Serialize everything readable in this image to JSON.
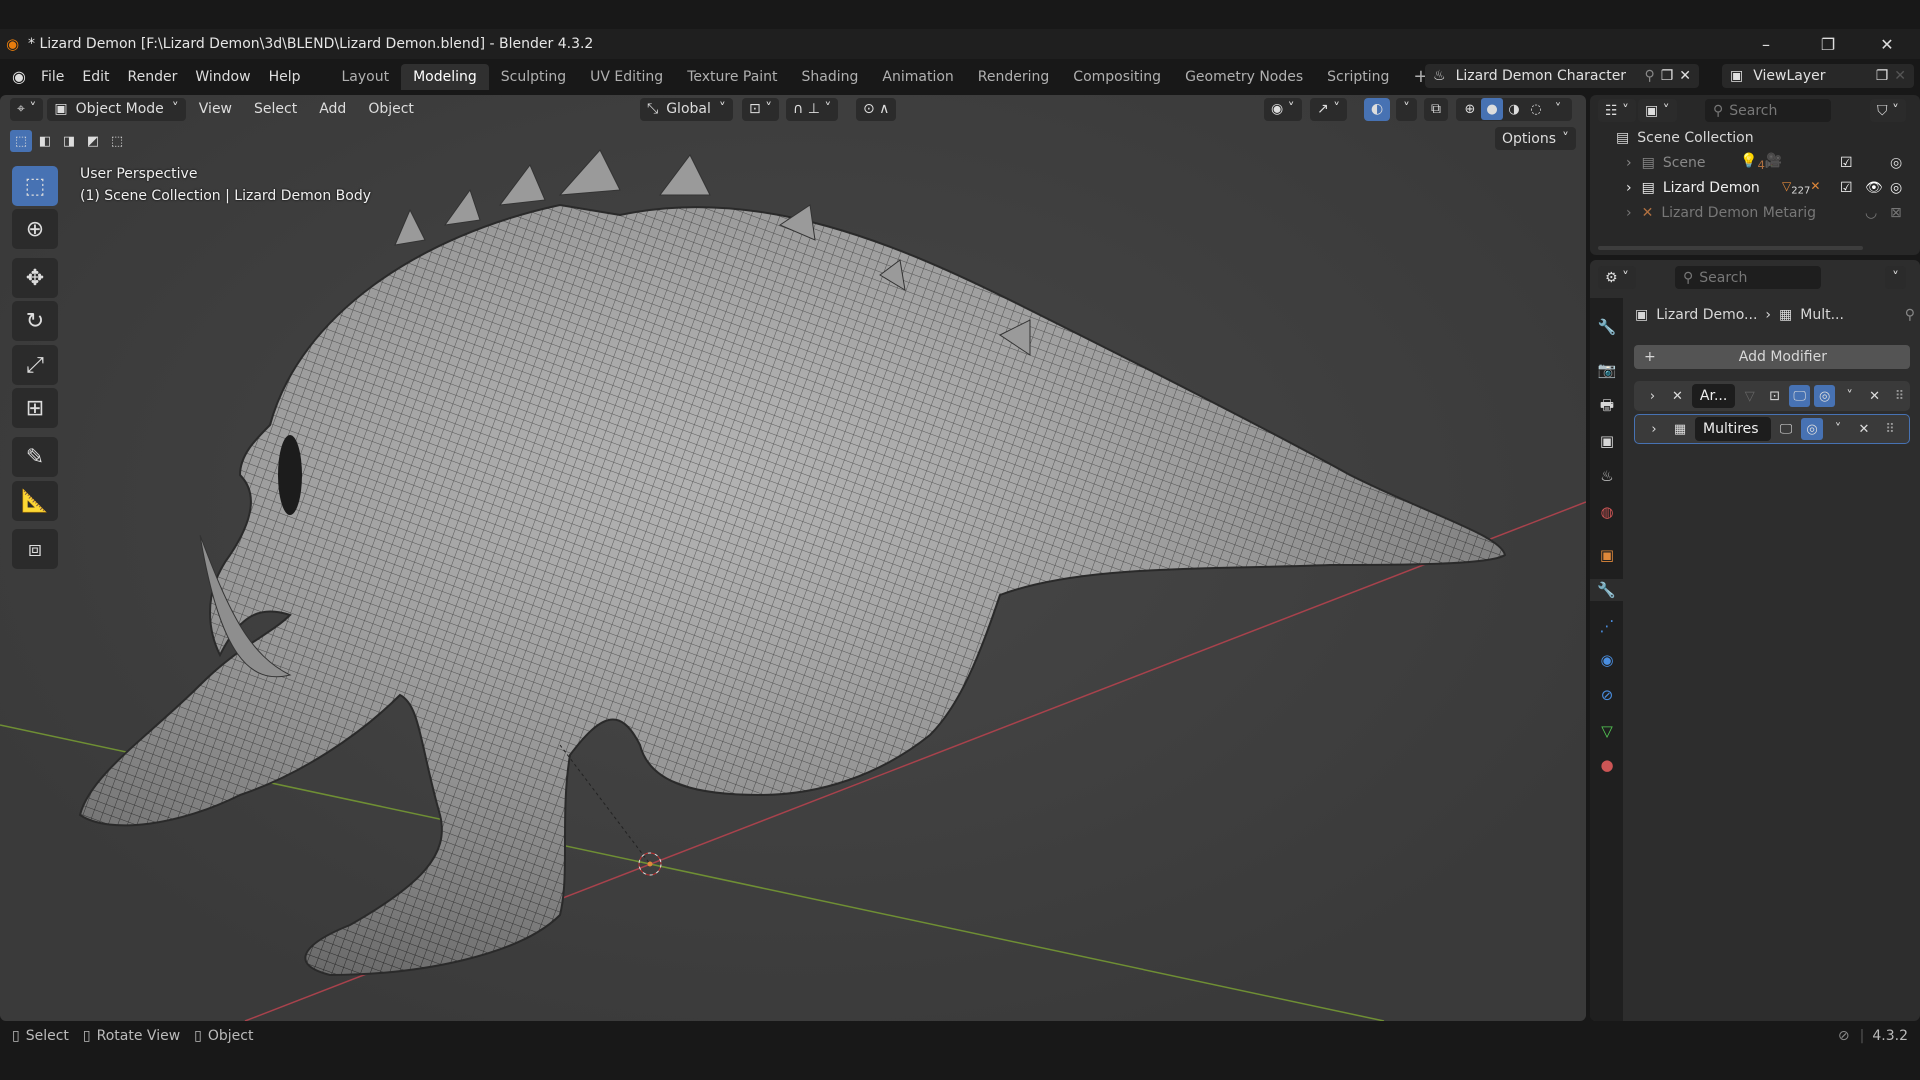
{
  "window": {
    "title": "* Lizard Demon [F:\\Lizard Demon\\3d\\BLEND\\Lizard Demon.blend] - Blender 4.3.2",
    "minimize": "–",
    "maximize": "❐",
    "close": "✕"
  },
  "menu": [
    "File",
    "Edit",
    "Render",
    "Window",
    "Help"
  ],
  "workspaces": [
    "Layout",
    "Modeling",
    "Sculpting",
    "UV Editing",
    "Texture Paint",
    "Shading",
    "Animation",
    "Rendering",
    "Compositing",
    "Geometry Nodes",
    "Scripting"
  ],
  "active_workspace": "Modeling",
  "add_workspace": "+",
  "scene": {
    "name": "Lizard Demon Character",
    "view_layer": "ViewLayer"
  },
  "viewport_header": {
    "mode": "Object Mode",
    "menus": [
      "View",
      "Select",
      "Add",
      "Object"
    ],
    "transform_orientation": "Global",
    "options": "Options"
  },
  "viewport_overlay": {
    "perspective": "User Perspective",
    "context": "(1) Scene Collection | Lizard Demon Body"
  },
  "outliner": {
    "search_placeholder": "Search",
    "root": "Scene Collection",
    "items": [
      {
        "label": "Scene",
        "badge": "4"
      },
      {
        "label": "Lizard Demon",
        "badge": "227"
      },
      {
        "label": "Lizard Demon Metarig",
        "badge": ""
      }
    ]
  },
  "properties": {
    "search_placeholder": "Search",
    "breadcrumb_object": "Lizard Demo...",
    "breadcrumb_modifier": "Mult...",
    "add_modifier": "Add Modifier",
    "modifiers": [
      {
        "name": "Ar...",
        "type": "armature"
      },
      {
        "name": "Multires",
        "type": "multires"
      }
    ]
  },
  "statusbar": {
    "items": [
      "Select",
      "Rotate View",
      "Object"
    ],
    "version": "4.3.2"
  },
  "colors": {
    "accent": "#4772b3",
    "x_axis": "#b0454f",
    "y_axis": "#7a9a3a",
    "object": "#e0883a"
  }
}
